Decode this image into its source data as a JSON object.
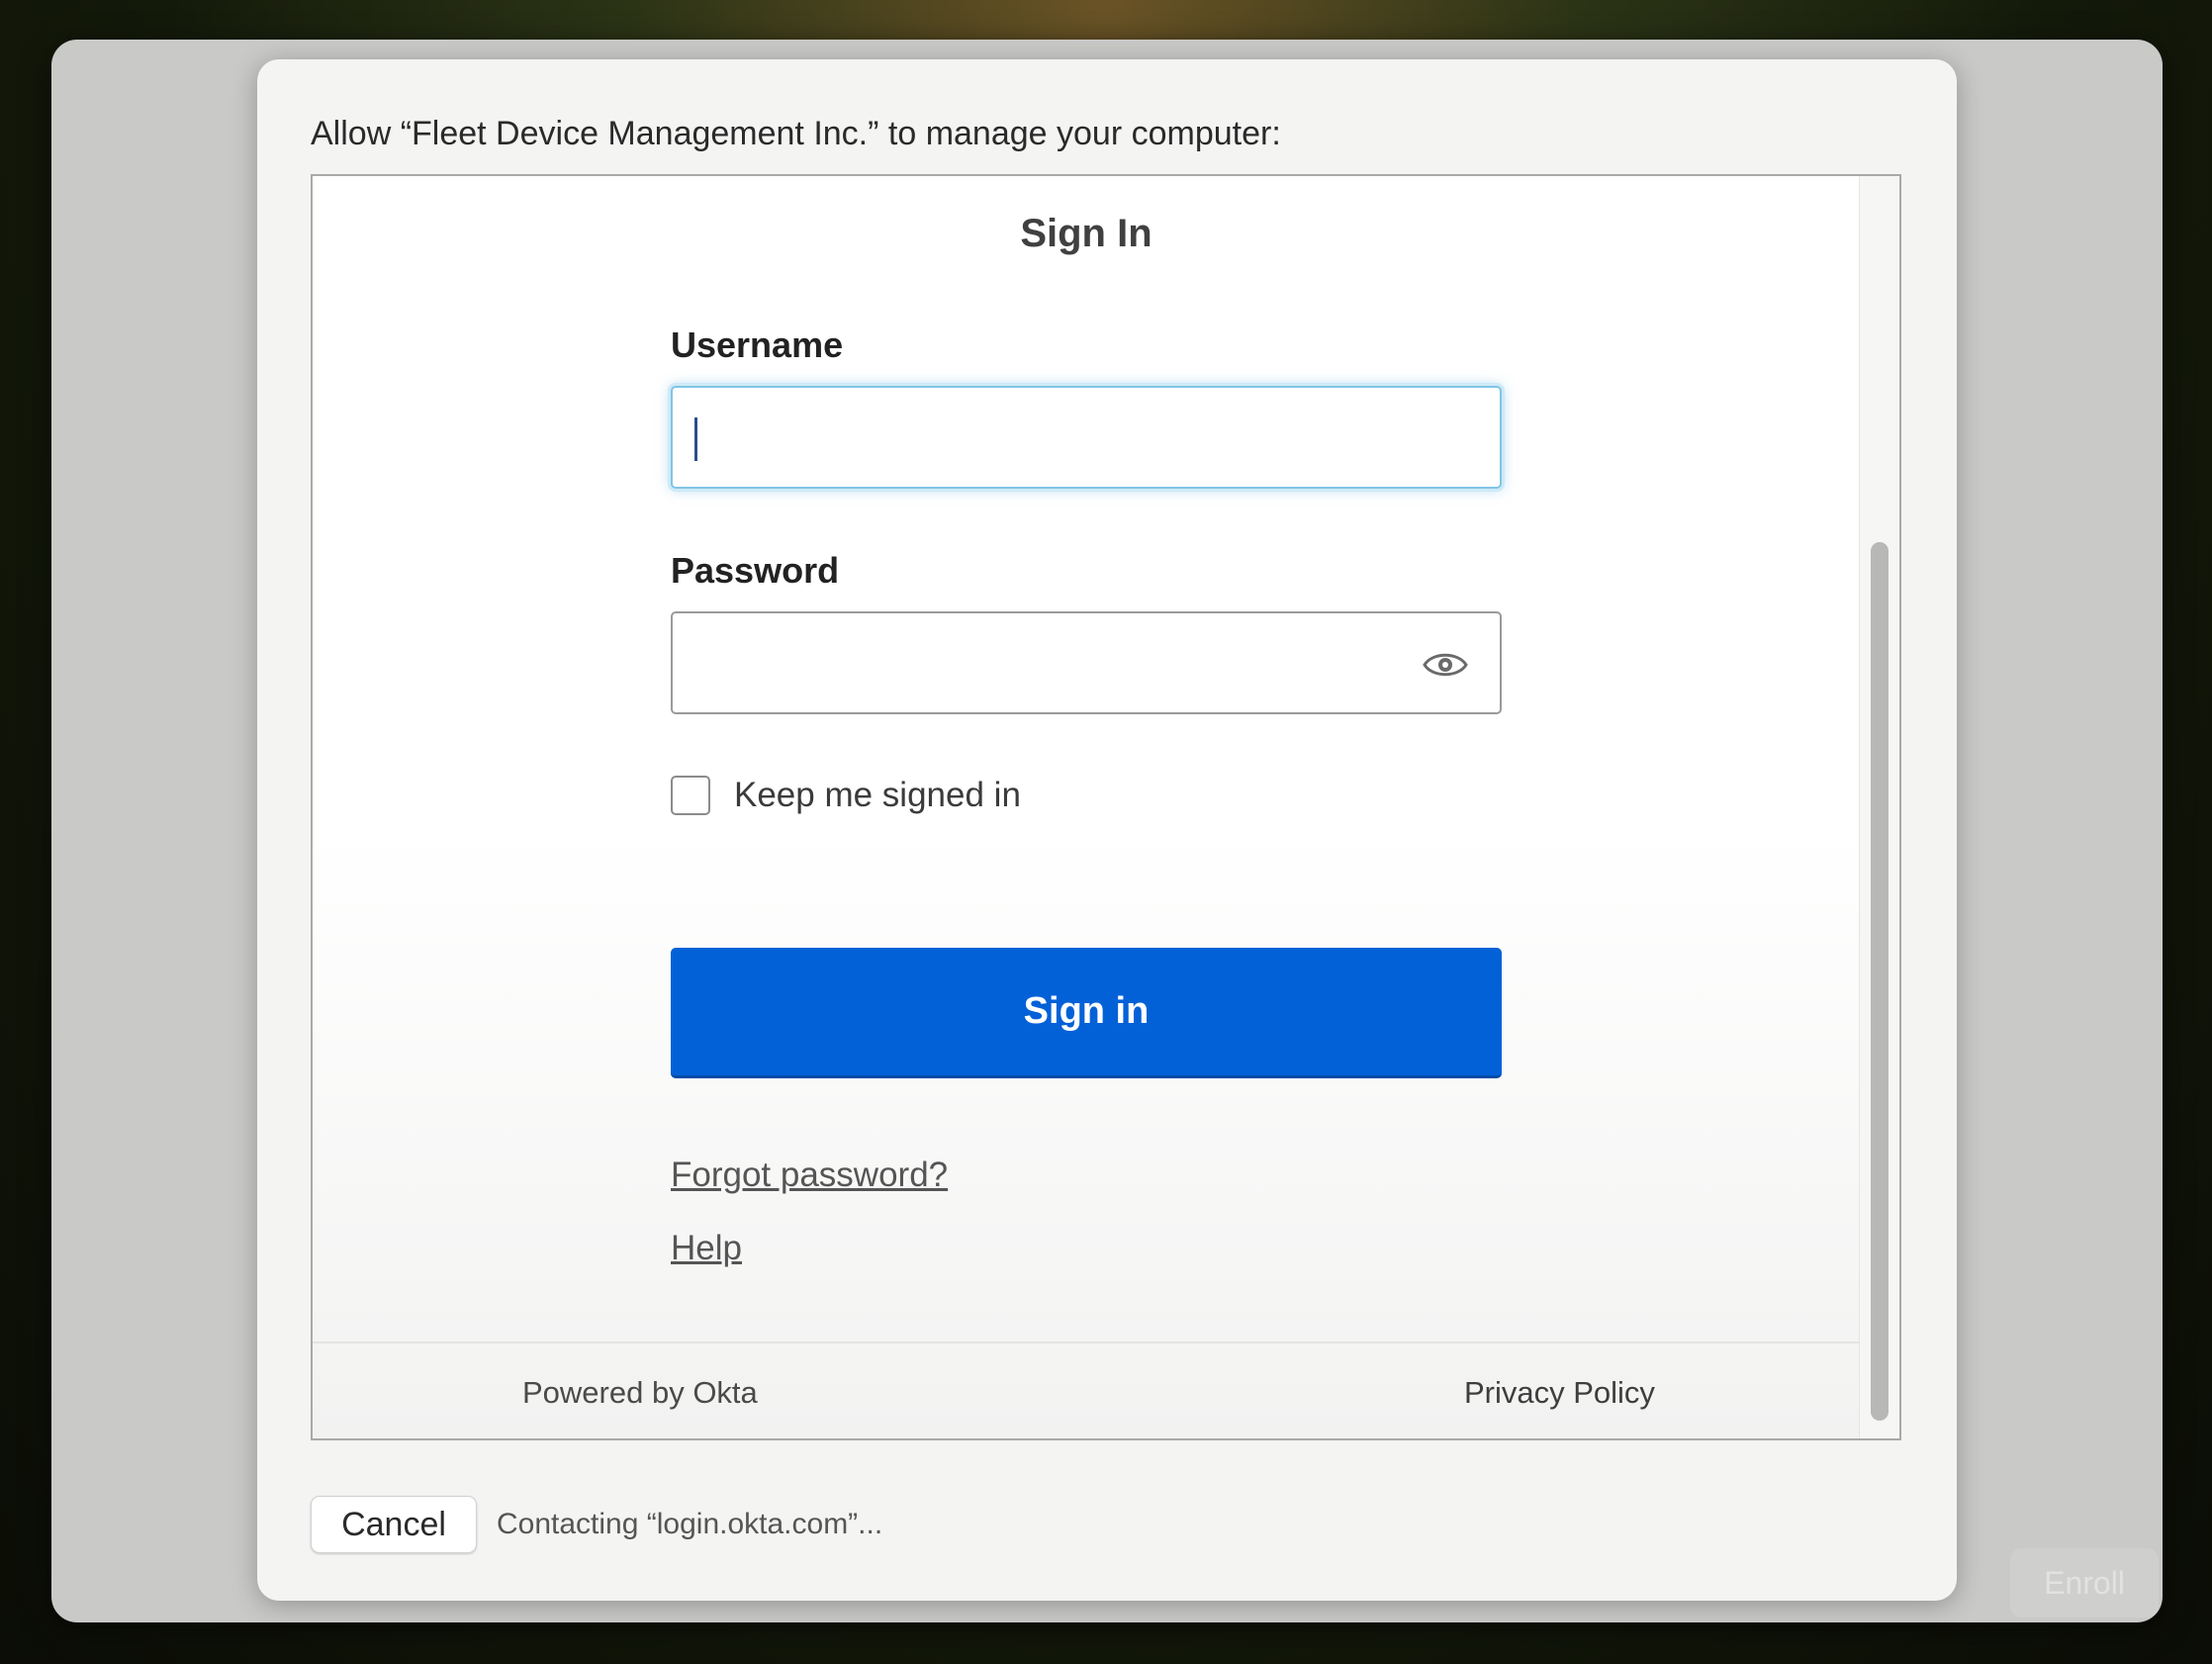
{
  "prompt": "Allow “Fleet Device Management Inc.” to manage your computer:",
  "signin": {
    "title": "Sign In",
    "username_label": "Username",
    "username_value": "",
    "password_label": "Password",
    "password_value": "",
    "keep_signed_in_label": "Keep me signed in",
    "keep_signed_in_checked": false,
    "signin_button": "Sign in",
    "forgot_password": "Forgot password?",
    "help": "Help"
  },
  "footer": {
    "powered_by": "Powered by Okta",
    "privacy": "Privacy Policy"
  },
  "dialog": {
    "cancel": "Cancel",
    "status": "Contacting “login.okta.com”...",
    "background_button": "Enroll"
  },
  "colors": {
    "primary_button": "#0361d8",
    "focus_ring": "#7fc4e6"
  },
  "icons": {
    "password_toggle": "eye-icon"
  }
}
